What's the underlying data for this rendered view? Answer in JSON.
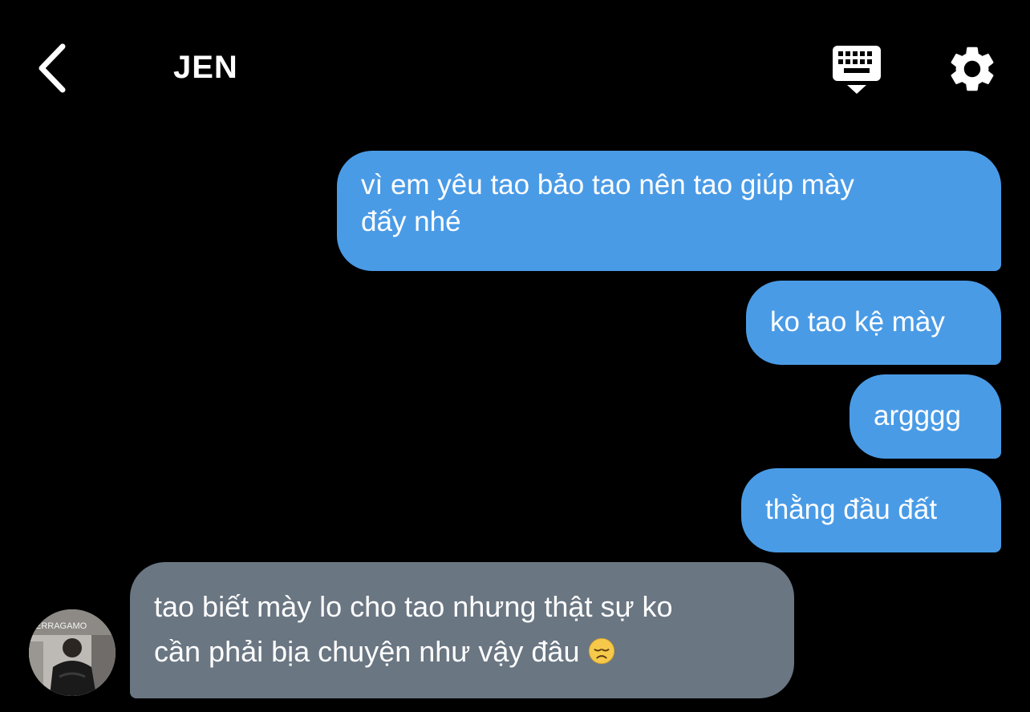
{
  "header": {
    "title": "JEN",
    "back_icon": "chevron-left-icon",
    "keyboard_icon": "keyboard-hide-icon",
    "settings_icon": "gear-icon"
  },
  "messages": [
    {
      "direction": "outgoing",
      "line1": "vì em yêu tao bảo tao nên tao giúp mày",
      "line2": "đấy nhé"
    },
    {
      "direction": "outgoing",
      "text": "ko tao kệ mày"
    },
    {
      "direction": "outgoing",
      "text": "argggg"
    },
    {
      "direction": "outgoing",
      "text": "thằng đầu đất"
    },
    {
      "direction": "incoming",
      "line1": "tao biết mày lo cho tao nhưng thật sự ko",
      "line2": "cần phải bịa chuyện như vậy đâu",
      "emoji": "disappointed-face"
    }
  ],
  "avatar": {
    "sign_text": "ERRAGAMO"
  },
  "colors": {
    "background": "#000000",
    "outgoing_bubble": "#4a9be6",
    "incoming_bubble": "#6a7682",
    "text": "#ffffff"
  }
}
